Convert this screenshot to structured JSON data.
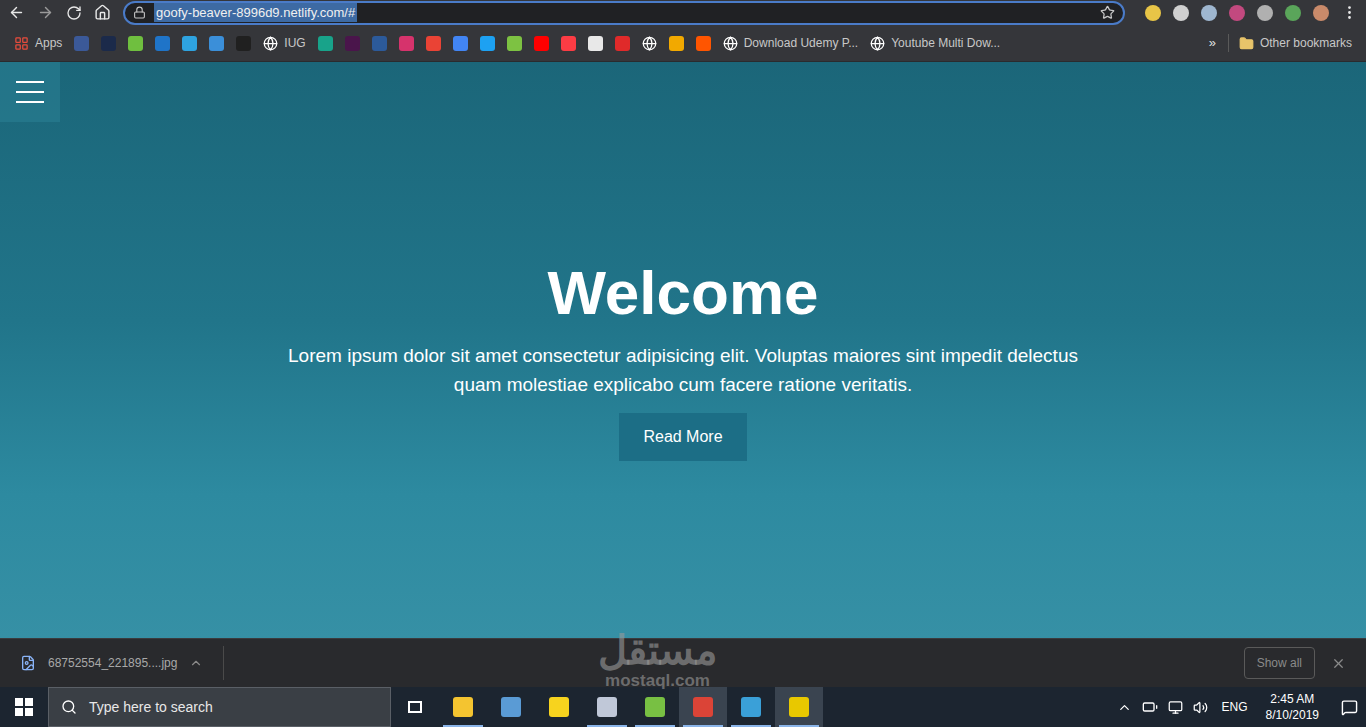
{
  "browser": {
    "url": "goofy-beaver-8996d9.netlify.com/#",
    "extensions": [
      {
        "color": "#e8c547"
      },
      {
        "color": "#d0d0d0"
      },
      {
        "color": "#9fb7d0"
      },
      {
        "color": "#c2497f"
      },
      {
        "color": "#b0b0b0"
      },
      {
        "color": "#5aa55a"
      },
      {
        "color": "#c98a6a"
      }
    ],
    "bookmarks": [
      {
        "label": "Apps",
        "kind": "apps",
        "color": "#e74c3c"
      },
      {
        "label": "",
        "kind": "icon",
        "color": "#3b5998"
      },
      {
        "label": "",
        "kind": "icon",
        "color": "#1b2a4a"
      },
      {
        "label": "",
        "kind": "icon",
        "color": "#6fbf3f"
      },
      {
        "label": "",
        "kind": "icon",
        "color": "#1f74c8"
      },
      {
        "label": "",
        "kind": "icon",
        "color": "#2ea3e0"
      },
      {
        "label": "",
        "kind": "icon",
        "color": "#3b8fd9"
      },
      {
        "label": "",
        "kind": "icon",
        "color": "#202020"
      },
      {
        "label": "IUG",
        "kind": "globe",
        "color": "#ffffff"
      },
      {
        "label": "",
        "kind": "icon",
        "color": "#18a38a"
      },
      {
        "label": "",
        "kind": "icon",
        "color": "#4a154b"
      },
      {
        "label": "",
        "kind": "icon",
        "color": "#2c5a9a"
      },
      {
        "label": "",
        "kind": "icon",
        "color": "#d6336c"
      },
      {
        "label": "",
        "kind": "icon",
        "color": "#ea4335"
      },
      {
        "label": "",
        "kind": "icon",
        "color": "#4285f4"
      },
      {
        "label": "",
        "kind": "icon",
        "color": "#1da1f2"
      },
      {
        "label": "",
        "kind": "icon",
        "color": "#7dc242"
      },
      {
        "label": "",
        "kind": "icon",
        "color": "#ff0000"
      },
      {
        "label": "",
        "kind": "icon",
        "color": "#fc3c44"
      },
      {
        "label": "",
        "kind": "icon",
        "color": "#e8e8e8"
      },
      {
        "label": "",
        "kind": "icon",
        "color": "#e02a2a"
      },
      {
        "label": "",
        "kind": "globe",
        "color": "#ffffff"
      },
      {
        "label": "",
        "kind": "icon",
        "color": "#f2a900"
      },
      {
        "label": "",
        "kind": "icon",
        "color": "#ff5500"
      },
      {
        "label": "Download Udemy P...",
        "kind": "globe",
        "color": "#ffffff"
      },
      {
        "label": "Youtube Multi Dow...",
        "kind": "globe",
        "color": "#ffffff"
      }
    ],
    "overflow": "»",
    "other_bookmarks": "Other bookmarks"
  },
  "page": {
    "heading": "Welcome",
    "text": "Lorem ipsum dolor sit amet consectetur adipisicing elit. Voluptas maiores sint impedit delectus quam molestiae explicabo cum facere ratione veritatis.",
    "button": "Read More"
  },
  "downloads": {
    "file": "68752554_221895....jpg",
    "show_all": "Show all"
  },
  "watermark": {
    "arabic": "مستقل",
    "latin": "mostaql.com"
  },
  "taskbar": {
    "search_placeholder": "Type here to search",
    "pinned": [
      {
        "color": "#f4c430",
        "running": true,
        "selected": false
      },
      {
        "color": "#5a9bd5",
        "running": false,
        "selected": false
      },
      {
        "color": "#f7d31e",
        "running": false,
        "selected": false
      },
      {
        "color": "#c0c8d8",
        "running": true,
        "selected": false
      },
      {
        "color": "#78c043",
        "running": true,
        "selected": false
      },
      {
        "color": "#db4437",
        "running": true,
        "selected": true
      },
      {
        "color": "#3aa0d8",
        "running": true,
        "selected": false
      },
      {
        "color": "#e8c800",
        "running": true,
        "selected": true
      }
    ],
    "language": "ENG",
    "time": "2:45 AM",
    "date": "8/10/2019"
  }
}
